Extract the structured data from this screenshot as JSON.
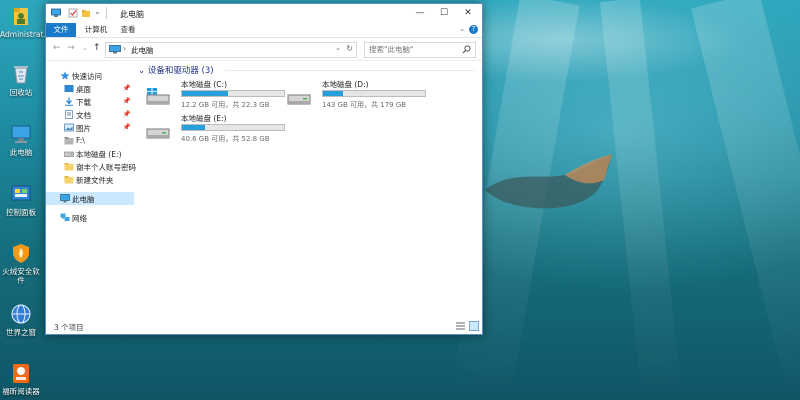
{
  "desktop": {
    "icons": [
      {
        "label": "Administrat...",
        "icon": "user-folder-icon"
      },
      {
        "label": "回收站",
        "icon": "recycle-bin-icon"
      },
      {
        "label": "此电脑",
        "icon": "this-pc-icon"
      },
      {
        "label": "控制面板",
        "icon": "control-panel-icon"
      },
      {
        "label": "火绒安全软件",
        "icon": "huorong-security-icon"
      },
      {
        "label": "世界之窗",
        "icon": "theworld-browser-icon"
      },
      {
        "label": "福昕阅读器",
        "icon": "foxit-pdf-reader-icon"
      }
    ],
    "colors": {
      "sea_top": "#2ea7bd",
      "sea_bottom": "#0f5566"
    }
  },
  "window": {
    "title": "此电脑",
    "controls": {
      "minimize": "—",
      "maximize": "☐",
      "close": "✕"
    },
    "ribbon": {
      "file": "文件",
      "computer": "计算机",
      "view": "查看",
      "help": "?"
    },
    "nav": {
      "back": "←",
      "forward": "→",
      "up": "↑",
      "recent": "⌄"
    },
    "address": {
      "path": "此电脑",
      "separator": "›",
      "dropdown": "⌄",
      "refresh": "↻"
    },
    "search": {
      "placeholder": "搜索\"此电脑\""
    },
    "navpane": [
      {
        "label": "快速访问",
        "icon": "star-icon",
        "pinned": false
      },
      {
        "label": "桌面",
        "icon": "desktop-folder-icon",
        "pinned": true
      },
      {
        "label": "下载",
        "icon": "download-folder-icon",
        "pinned": true
      },
      {
        "label": "文档",
        "icon": "documents-folder-icon",
        "pinned": true
      },
      {
        "label": "图片",
        "icon": "pictures-folder-icon",
        "pinned": true
      },
      {
        "label": "F:\\",
        "icon": "folder-icon",
        "pinned": false
      },
      {
        "label": "本地磁盘 (E:)",
        "icon": "drive-icon",
        "pinned": false
      },
      {
        "label": "谢丰个人账号密码",
        "icon": "folder-icon",
        "pinned": false
      },
      {
        "label": "新建文件夹",
        "icon": "folder-icon",
        "pinned": false
      },
      {
        "label": "此电脑",
        "icon": "this-pc-icon",
        "pinned": false
      },
      {
        "label": "网络",
        "icon": "network-icon",
        "pinned": false
      }
    ],
    "pin_glyph": "📌",
    "section_title": "设备和驱动器 (3)",
    "drives": [
      {
        "name": "本地磁盘 (C:)",
        "info": "12.2 GB 可用，共 22.3 GB",
        "used_fraction": 0.45
      },
      {
        "name": "本地磁盘 (D:)",
        "info": "143 GB 可用，共 179 GB",
        "used_fraction": 0.2
      },
      {
        "name": "本地磁盘 (E:)",
        "info": "40.6 GB 可用，共 52.8 GB",
        "used_fraction": 0.23
      }
    ],
    "status": "3 个项目",
    "colors": {
      "accent": "#1979ca",
      "drive_fill": "#26a0da",
      "selection": "#cce8ff",
      "group_title": "#1e3287"
    }
  }
}
